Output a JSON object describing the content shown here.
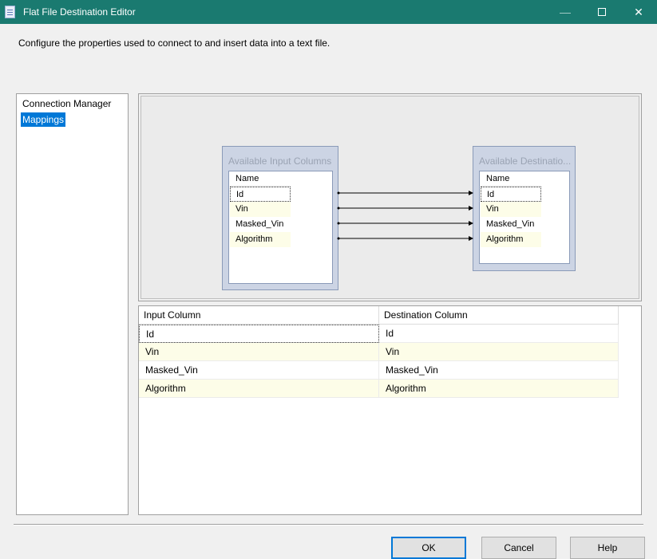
{
  "window": {
    "title": "Flat File Destination Editor",
    "icon": "document-icon",
    "controls": {
      "minimize": "—",
      "maximize": "□",
      "close": "✕"
    }
  },
  "description": "Configure the properties used to connect to and insert data into a text file.",
  "nav": {
    "items": [
      {
        "label": "Connection Manager",
        "selected": false
      },
      {
        "label": "Mappings",
        "selected": true
      }
    ]
  },
  "mapping_diagram": {
    "input_box": {
      "title": "Available Input Columns",
      "header": "Name",
      "columns": [
        "Id",
        "Vin",
        "Masked_Vin",
        "Algorithm"
      ]
    },
    "destination_box": {
      "title": "Available Destinatio...",
      "header": "Name",
      "columns": [
        "Id",
        "Vin",
        "Masked_Vin",
        "Algorithm"
      ]
    }
  },
  "grid": {
    "headers": [
      "Input Column",
      "Destination Column"
    ],
    "rows": [
      {
        "input": "Id",
        "destination": "Id"
      },
      {
        "input": "Vin",
        "destination": "Vin"
      },
      {
        "input": "Masked_Vin",
        "destination": "Masked_Vin"
      },
      {
        "input": "Algorithm",
        "destination": "Algorithm"
      }
    ]
  },
  "buttons": {
    "ok": "OK",
    "cancel": "Cancel",
    "help": "Help"
  },
  "colors": {
    "titlebar": "#1a7a70",
    "selection": "#0078d7",
    "row_alt": "#fdfde8",
    "box_fill": "#ccd4e4"
  }
}
